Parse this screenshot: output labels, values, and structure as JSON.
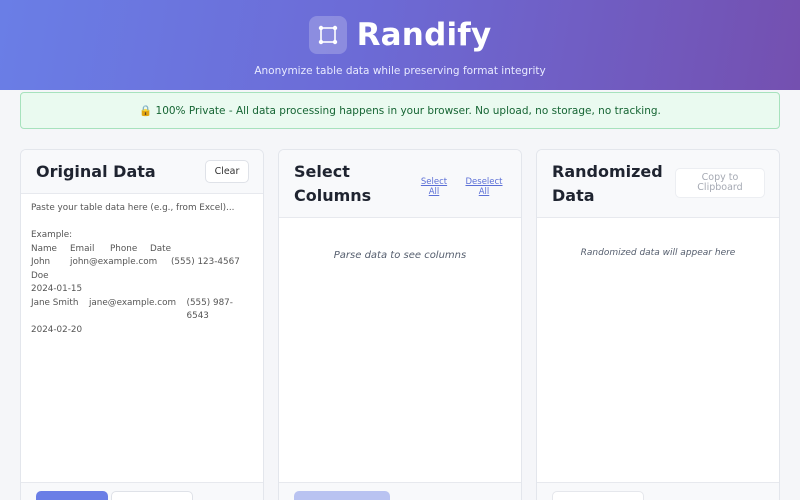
{
  "header": {
    "title": "Randify",
    "subtitle": "Anonymize table data while preserving format integrity",
    "logo_icon": "crop-square-icon"
  },
  "notice": {
    "icon": "lock-icon",
    "text": "🔒 100% Private - All data processing happens in your browser. No upload, no storage, no tracking."
  },
  "panels": {
    "original": {
      "title": "Original Data",
      "clear_label": "Clear",
      "placeholder_intro": "Paste your table data here (e.g., from Excel)...",
      "example_label": "Example:",
      "example_headers": [
        "Name",
        "Email",
        "Phone",
        "Date"
      ],
      "example_rows": [
        {
          "name": "John Doe",
          "email": "john@example.com",
          "phone": "(555) 123-4567",
          "date": "2024-01-15"
        },
        {
          "name": "Jane Smith",
          "email": "jane@example.com",
          "phone": "(555) 987-6543",
          "date": "2024-02-20"
        }
      ]
    },
    "columns": {
      "title_line1": "Select",
      "title_line2": "Columns",
      "select_all_line1": "Select",
      "select_all_line2": "All",
      "deselect_all_line1": "Deselect",
      "deselect_all_line2": "All",
      "empty_message": "Parse data to see columns"
    },
    "randomized": {
      "title_line1": "Randomized",
      "title_line2": "Data",
      "copy_line1": "Copy to",
      "copy_line2": "Clipboard",
      "empty_message": "Randomized data will appear here"
    }
  },
  "colors": {
    "accent": "#6a7ee6",
    "accent_dark": "#7450b0",
    "notice_bg": "#eafaf0",
    "notice_text": "#166534",
    "link": "#5b6fd6"
  }
}
